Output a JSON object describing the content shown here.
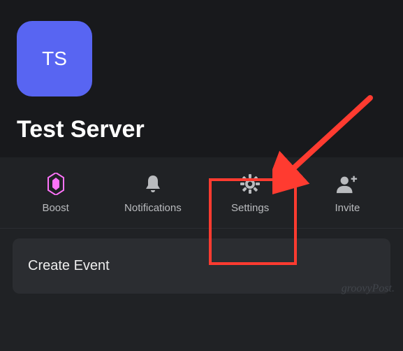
{
  "server": {
    "initials": "TS",
    "name": "Test Server"
  },
  "actions": {
    "boost": {
      "label": "Boost"
    },
    "notifications": {
      "label": "Notifications"
    },
    "settings": {
      "label": "Settings"
    },
    "invite": {
      "label": "Invite"
    }
  },
  "event_card": {
    "title": "Create Event"
  },
  "watermark": "groovyPost."
}
